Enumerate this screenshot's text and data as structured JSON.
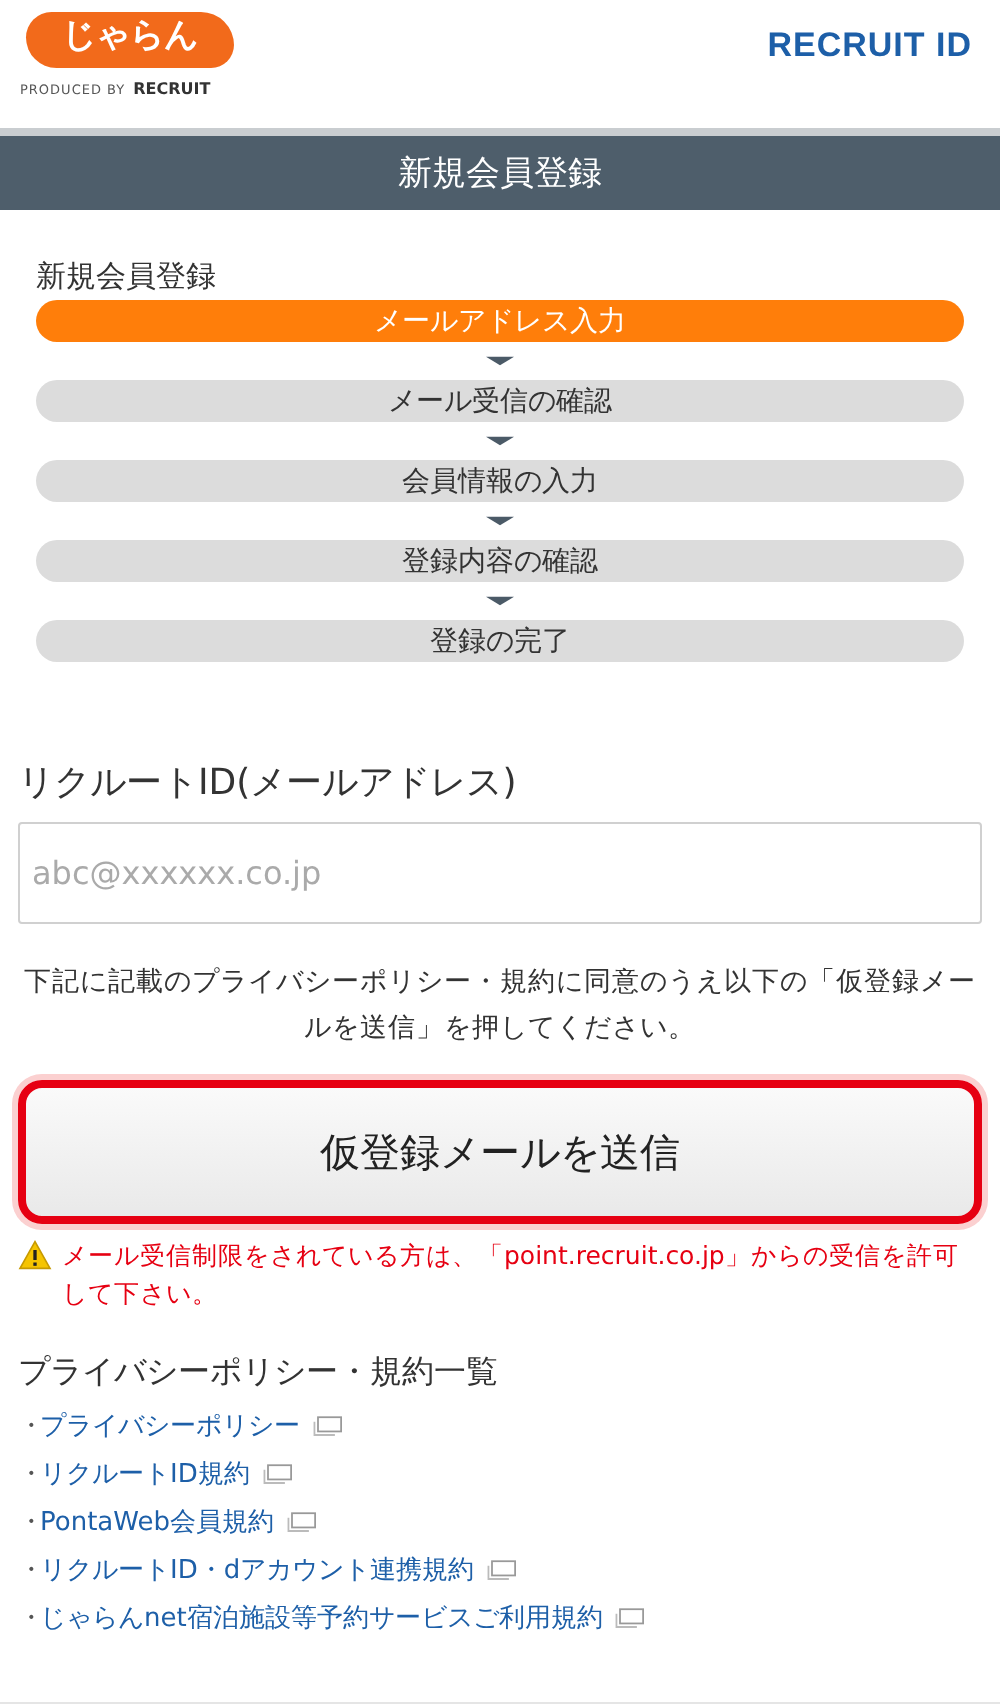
{
  "header": {
    "logo_text": "じゃらん",
    "produced_by": "PRODUCED BY",
    "produced_brand": "RECRUIT",
    "brand": "RECRUIT",
    "brand_suffix": "ID"
  },
  "title_bar": "新規会員登録",
  "steps_title": "新規会員登録",
  "steps": [
    {
      "label": "メールアドレス入力",
      "selected": true
    },
    {
      "label": "メール受信の確認",
      "selected": false
    },
    {
      "label": "会員情報の入力",
      "selected": false
    },
    {
      "label": "登録内容の確認",
      "selected": false
    },
    {
      "label": "登録の完了",
      "selected": false
    }
  ],
  "email_field": {
    "label": "リクルートID(メールアドレス)",
    "placeholder": "abc@xxxxxx.co.jp"
  },
  "instruction": "下記に記載のプライバシーポリシー・規約に同意のうえ以下の「仮登録メールを送信」を押してください。",
  "submit_button": {
    "label": "仮登録メールを送信",
    "highlighted": true
  },
  "warning": "メール受信制限をされている方は、「point.recruit.co.jp」からの受信を許可して下さい。",
  "policies": {
    "title": "プライバシーポリシー・規約一覧",
    "links": [
      {
        "bullet": "・",
        "label": "プライバシーポリシー"
      },
      {
        "bullet": "・",
        "label": "リクルートID規約"
      },
      {
        "bullet": "・",
        "label": "PontaWeb会員規約"
      },
      {
        "bullet": "・",
        "label": "リクルートID・dアカウント連携規約"
      },
      {
        "bullet": "・",
        "label": "じゃらんnet宿泊施設等予約サービスご利用規約"
      }
    ]
  }
}
